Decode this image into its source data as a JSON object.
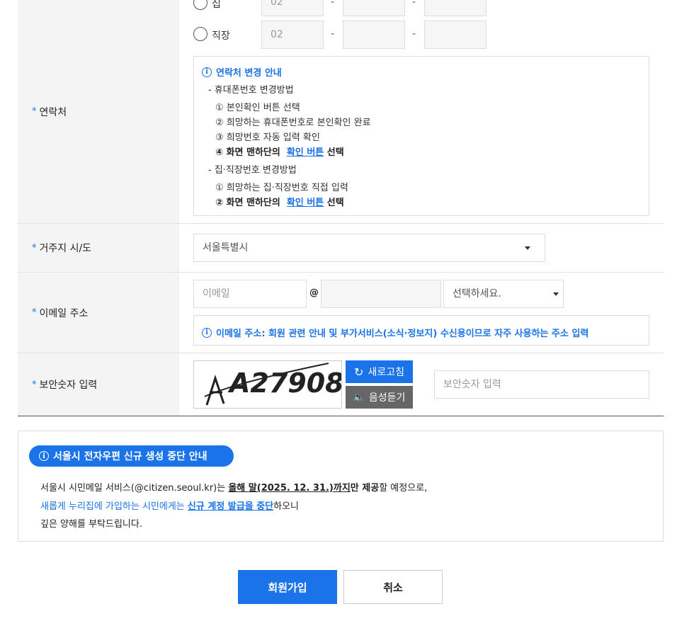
{
  "contact": {
    "label": "연락처",
    "home_label": "집",
    "work_label": "직장",
    "area_code": "02",
    "dash": "-",
    "info": {
      "title": "연락처 변경 안내",
      "mobile_header": "- 휴대폰번호 변경방법",
      "mobile_steps": [
        "① 본인확인 버튼 선택",
        "② 희망하는 휴대폰번호로 본인확인 완료",
        "③ 희망번호 자동 입력 확인"
      ],
      "mobile_step4_prefix": "④ 화면 맨하단의",
      "confirm_link": "확인 버튼",
      "select_word": "선택",
      "landline_header": "- 집·직장번호 변경방법",
      "landline_step1": "① 희망하는 집·직장번호 직접 입력",
      "landline_step2_prefix": "② 화면 맨하단의"
    }
  },
  "region": {
    "label": "거주지 시/도",
    "value": "서울특별시"
  },
  "email": {
    "label": "이메일 주소",
    "placeholder": "이메일",
    "at": "@",
    "domain_select": "선택하세요.",
    "info": "이메일 주소: 회원 관련 안내 및 부가서비스(소식·정보지) 수신용이므로 자주 사용하는 주소 입력"
  },
  "captcha": {
    "label": "보안숫자 입력",
    "image_text": "A27908",
    "refresh_label": "새로고침",
    "audio_label": "음성듣기",
    "placeholder": "보안숫자 입력"
  },
  "notice": {
    "title": "서울시 전자우편 신규 생성 중단 안내",
    "line1_a": "서울시 시민메일 서비스(@citizen.seoul.kr)는 ",
    "line1_b": "올해 말(2025. 12. 31.)까지",
    "line1_c": "만 ",
    "line1_d": "제공",
    "line1_e": "할 예정으로,",
    "line2_a": "새롭게 누리집에 가입하는 시민에게는 ",
    "line2_b": "신규 계정 발급을 중단",
    "line2_c": "하오니",
    "line3": "깊은 양해를 부탁드립니다."
  },
  "buttons": {
    "submit": "회원가입",
    "cancel": "취소"
  },
  "required_mark": "*",
  "colors": {
    "accent": "#1a73e8",
    "audio_button": "#666666"
  }
}
